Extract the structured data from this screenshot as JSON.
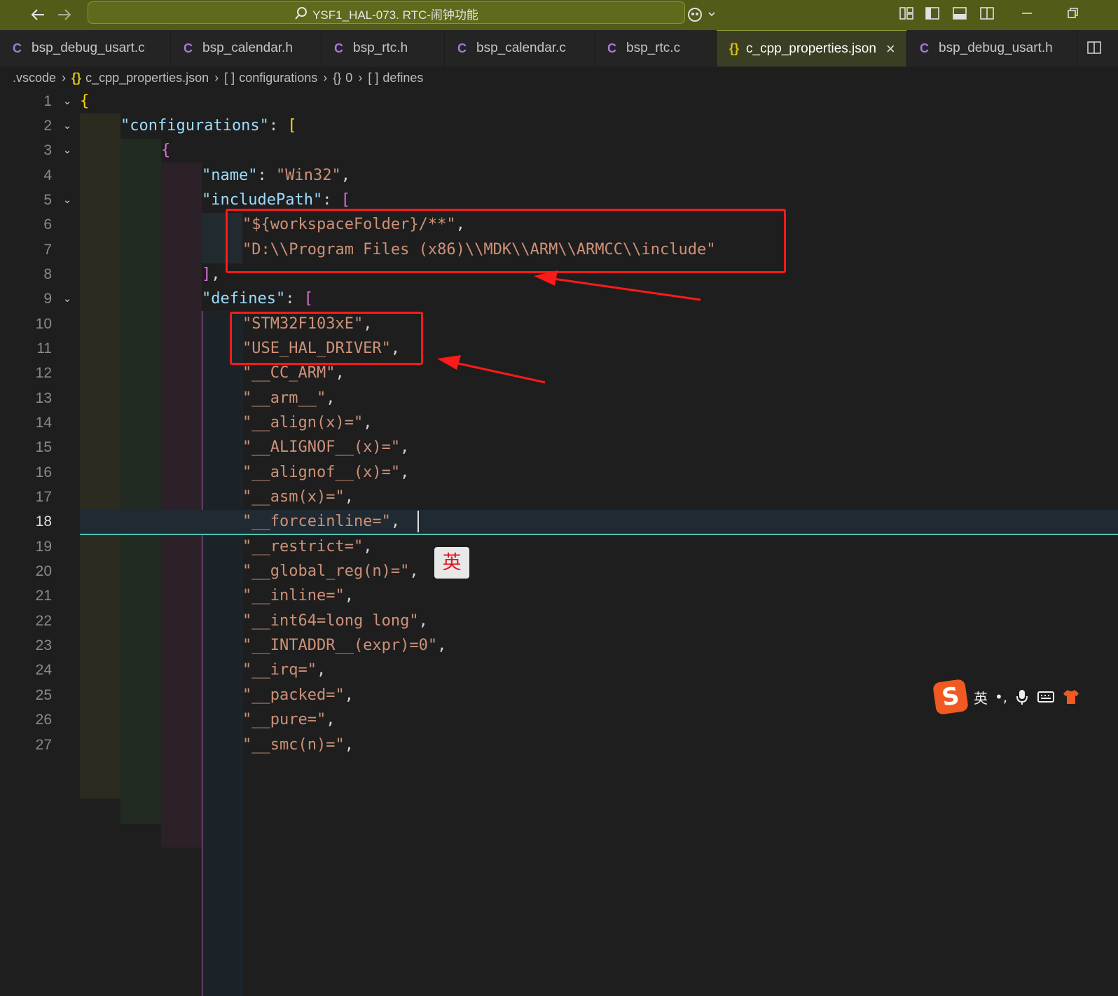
{
  "titlebar": {
    "title": "YSF1_HAL-073. RTC-闹钟功能",
    "back_icon": "arrow-left-icon",
    "forward_icon": "arrow-right-icon",
    "search_icon": "search-icon",
    "accent_color": "#525b18"
  },
  "tabs": [
    {
      "icon": "C",
      "label": "bsp_debug_usart.c"
    },
    {
      "icon": "C",
      "label": "bsp_calendar.h"
    },
    {
      "icon": "C",
      "label": "bsp_rtc.h"
    },
    {
      "icon": "C",
      "label": "bsp_calendar.c"
    },
    {
      "icon": "C",
      "label": "bsp_rtc.c"
    },
    {
      "icon": "{}",
      "label": "c_cpp_properties.json",
      "active": true,
      "close": "×"
    },
    {
      "icon": "C",
      "label": "bsp_debug_usart.h"
    }
  ],
  "breadcrumb": {
    "folder": ".vscode",
    "file_icon": "{}",
    "file": "c_cpp_properties.json",
    "c1_icon": "[ ]",
    "c1": "configurations",
    "c2_icon": "{}",
    "c2": "0",
    "c3_icon": "[ ]",
    "c3": "defines"
  },
  "editor": {
    "current_line": "18",
    "lines": [
      {
        "n": "1"
      },
      {
        "n": "2"
      },
      {
        "n": "3"
      },
      {
        "n": "4"
      },
      {
        "n": "5"
      },
      {
        "n": "6"
      },
      {
        "n": "7"
      },
      {
        "n": "8"
      },
      {
        "n": "9"
      },
      {
        "n": "10"
      },
      {
        "n": "11"
      },
      {
        "n": "12"
      },
      {
        "n": "13"
      },
      {
        "n": "14"
      },
      {
        "n": "15"
      },
      {
        "n": "16"
      },
      {
        "n": "17"
      },
      {
        "n": "18"
      },
      {
        "n": "19"
      },
      {
        "n": "20"
      },
      {
        "n": "21"
      },
      {
        "n": "22"
      },
      {
        "n": "23"
      },
      {
        "n": "24"
      },
      {
        "n": "25"
      },
      {
        "n": "26"
      },
      {
        "n": "27"
      }
    ],
    "code": {
      "l1_brace": "{",
      "l2_key": "\"configurations\"",
      "l2_colon": ": ",
      "l2_br": "[",
      "l3_brace": "{",
      "l4_key": "\"name\"",
      "l4_colon": ": ",
      "l4_val": "\"Win32\"",
      "l4_comma": ",",
      "l5_key": "\"includePath\"",
      "l5_colon": ": ",
      "l5_br": "[",
      "l6_val": "\"${workspaceFolder}/**\"",
      "l6_comma": ",",
      "l7_val": "\"D:\\\\Program Files (x86)\\\\MDK\\\\ARM\\\\ARMCC\\\\include\"",
      "l8_br": "]",
      "l8_comma": ",",
      "l9_key": "\"defines\"",
      "l9_colon": ": ",
      "l9_br": "[",
      "defines": [
        "\"STM32F103xE\"",
        "\"USE_HAL_DRIVER\"",
        "\"__CC_ARM\"",
        "\"__arm__\"",
        "\"__align(x)=\"",
        "\"__ALIGNOF__(x)=\"",
        "\"__alignof__(x)=\"",
        "\"__asm(x)=\"",
        "\"__forceinline=\"",
        "\"__restrict=\"",
        "\"__global_reg(n)=\"",
        "\"__inline=\"",
        "\"__int64=long long\"",
        "\"__INTADDR__(expr)=0\"",
        "\"__irq=\"",
        "\"__packed=\"",
        "\"__pure=\"",
        "\"__smc(n)=\""
      ],
      "comma": ","
    }
  },
  "ime": {
    "inline_indicator": "英",
    "logo": "S",
    "mode": "英",
    "punct": "•,",
    "mic_icon": "microphone-icon",
    "keyboard_icon": "keyboard-icon",
    "skin_icon": "shirt-icon"
  },
  "colors": {
    "key": "#9cdcfe",
    "string": "#ce9178",
    "bracket_level1": "#ffd700",
    "bracket_level2": "#da70d6",
    "bracket_level3": "#179fff",
    "annotation_box": "#ff1a1a"
  }
}
